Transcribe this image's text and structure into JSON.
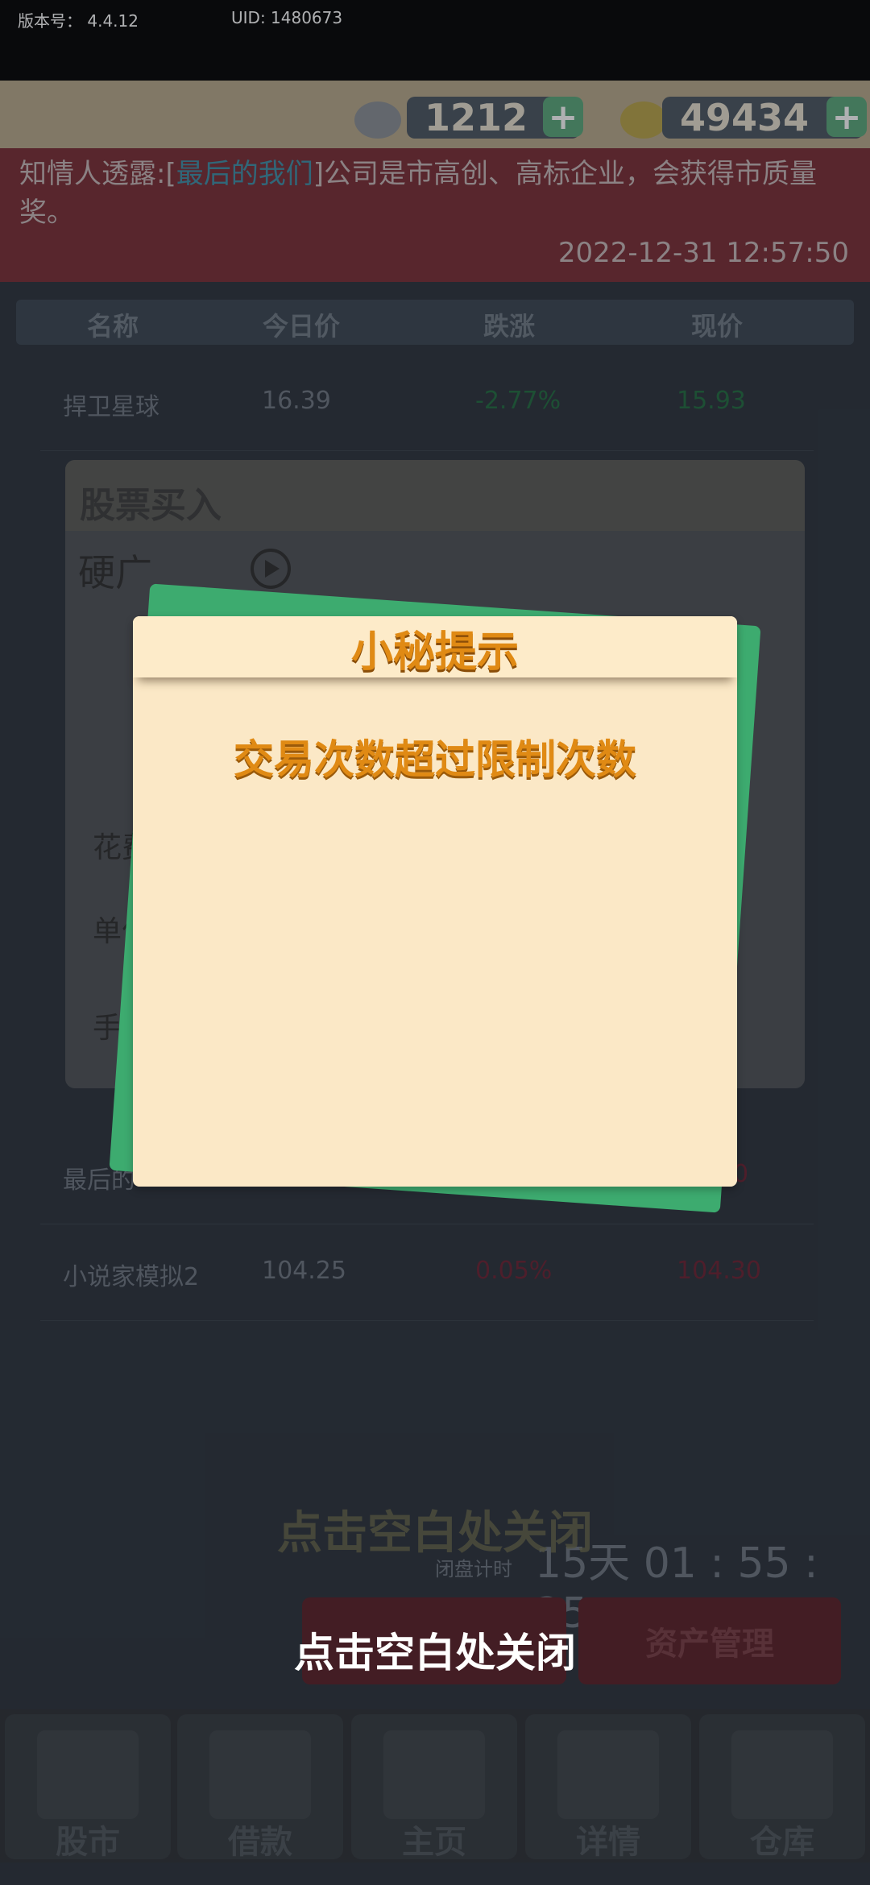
{
  "status": {
    "version_label": "版本号：",
    "version": "4.4.12",
    "uid": "UID: 1480673"
  },
  "resources": {
    "diamonds": "1212",
    "coins": "49434"
  },
  "news": {
    "prefix": "知情人透露:[",
    "company": "最后的我们",
    "suffix": "]公司是市高创、高标企业，会获得市质量奖。",
    "timestamp": "2022-12-31 12:57:50"
  },
  "table": {
    "headers": [
      "名称",
      "今日价",
      "跌涨",
      "现价"
    ],
    "rows": [
      {
        "name": "捍卫星球",
        "today": "16.39",
        "change": "-2.77%",
        "current": "15.93"
      },
      {
        "name": "最后的",
        "today": "",
        "change": "",
        "current": "0"
      },
      {
        "name": "小说家模拟2",
        "today": "104.25",
        "change": "0.05%",
        "current": "104.30"
      }
    ]
  },
  "buy_panel": {
    "title": "股票买入",
    "stock": "硬广",
    "labels": [
      "花费",
      "单价",
      "手数"
    ]
  },
  "timer": {
    "label": "闭盘计时",
    "value": "15天 01 : 55 : 25"
  },
  "buttons": {
    "left": "",
    "asset": "资产管理"
  },
  "tabs": [
    "股市",
    "借款",
    "主页",
    "详情",
    "仓库"
  ],
  "dialog": {
    "title": "小秘提示",
    "message": "交易次数超过限制次数"
  },
  "close_hint": "点击空白处关闭",
  "colors": {
    "green_card": "#3dab6f",
    "dialog_bg": "#fbe8c6",
    "dialog_text": "#e08a14",
    "news_bg": "#7a2b34"
  }
}
